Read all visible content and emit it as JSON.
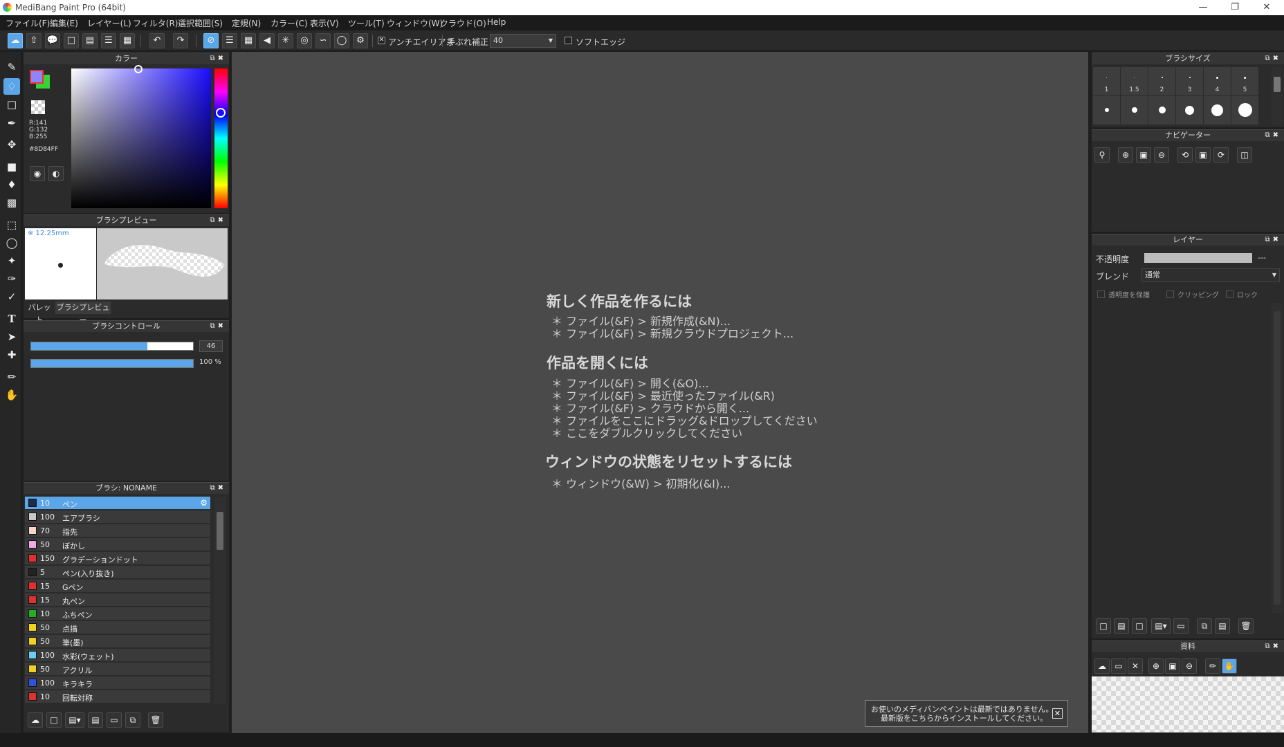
{
  "window": {
    "title": "MediBang Paint Pro (64bit)"
  },
  "menu": [
    "ファイル(F)",
    "編集(E)",
    "レイヤー(L)",
    "フィルタ(R)",
    "選択範囲(S)",
    "定規(N)",
    "カラー(C)",
    "表示(V)",
    "ツール(T)",
    "ウィンドウ(W)",
    "クラウド(O)",
    "Help"
  ],
  "toolbar": {
    "antialias_label": "アンチエイリアス",
    "stabilizer_label": "手ぶれ補正",
    "stabilizer_value": "40",
    "softedge_label": "ソフトエッジ"
  },
  "color_panel": {
    "title": "カラー",
    "r": "R:141",
    "g": "G:132",
    "b": "B:255",
    "hex": "#8D84FF",
    "primary_color": "#8D84FF",
    "secondary_color": "#39d333"
  },
  "brush_preview": {
    "title": "ブラシプレビュー",
    "size": "※ 12.25mm",
    "tabs": [
      "パレット",
      "ブラシプレビュー"
    ]
  },
  "brush_control": {
    "title": "ブラシコントロール",
    "size_value": "46",
    "size_percent": 0.72,
    "opacity_value": "100 %",
    "opacity_percent": 1.0
  },
  "brush_list": {
    "title": "ブラシ: NONAME",
    "items": [
      {
        "size": "10",
        "name": "ペン",
        "color": "#1e2a4a",
        "selected": true
      },
      {
        "size": "100",
        "name": "エアブラシ",
        "color": "#c8c8c8"
      },
      {
        "size": "70",
        "name": "指先",
        "color": "#f5d6c8"
      },
      {
        "size": "50",
        "name": "ぼかし",
        "color": "#f0a8e8"
      },
      {
        "size": "150",
        "name": "グラデーションドット",
        "color": "#e03030"
      },
      {
        "size": "5",
        "name": "ペン(入り抜き)",
        "color": "#222222"
      },
      {
        "size": "15",
        "name": "Gペン",
        "color": "#e03030"
      },
      {
        "size": "15",
        "name": "丸ペン",
        "color": "#e03030"
      },
      {
        "size": "10",
        "name": "ふちペン",
        "color": "#22b022"
      },
      {
        "size": "50",
        "name": "点描",
        "color": "#f0d020"
      },
      {
        "size": "50",
        "name": "筆(墨)",
        "color": "#f0d020"
      },
      {
        "size": "100",
        "name": "水彩(ウェット)",
        "color": "#6ad0f0"
      },
      {
        "size": "50",
        "name": "アクリル",
        "color": "#f0d020"
      },
      {
        "size": "100",
        "name": "キラキラ",
        "color": "#3050e0"
      },
      {
        "size": "10",
        "name": "回転対称",
        "color": "#e03030"
      }
    ]
  },
  "canvas_help": {
    "h1": "新しく作品を作るには",
    "h1_lines": [
      "＊ ファイル(&F) > 新規作成(&N)...",
      "＊ ファイル(&F) > 新規クラウドプロジェクト..."
    ],
    "h2": "作品を開くには",
    "h2_lines": [
      "＊ ファイル(&F) > 開く(&O)...",
      "＊ ファイル(&F) > 最近使ったファイル(&R)",
      "＊ ファイル(&F) > クラウドから開く...",
      "＊ ファイルをここにドラッグ&ドロップしてください",
      "＊ ここをダブルクリックしてください"
    ],
    "h3": "ウィンドウの状態をリセットするには",
    "h3_lines": [
      "＊ ウィンドウ(&W) > 初期化(&I)..."
    ]
  },
  "update_notice": {
    "line1": "お使いのメディバンペイントは最新ではありません。",
    "line2": "最新版をこちらからインストールしてください。"
  },
  "brush_size_panel": {
    "title": "ブラシサイズ",
    "labels": [
      "1",
      "1.5",
      "2",
      "3",
      "4",
      "5"
    ]
  },
  "navigator": {
    "title": "ナビゲーター"
  },
  "layer_panel": {
    "title": "レイヤー",
    "opacity_label": "不透明度",
    "opacity_value": "---",
    "blend_label": "ブレンド",
    "blend_value": "通常",
    "protect_alpha": "透明度を保護",
    "clipping": "クリッピング",
    "lock": "ロック"
  },
  "materials": {
    "title": "資料"
  }
}
